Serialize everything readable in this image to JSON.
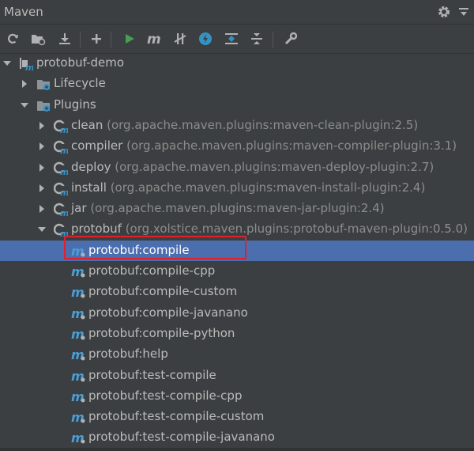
{
  "window": {
    "title": "Maven"
  },
  "colors": {
    "background": "#3c3f41",
    "selection": "#4b6eaf",
    "highlight_box": "#e0202a",
    "run_green": "#499c54",
    "skip_tests_blue": "#3592c4"
  },
  "toolbar": {
    "buttons": [
      {
        "name": "reimport",
        "icon": "refresh-icon"
      },
      {
        "name": "generate-sources",
        "icon": "generate-sources-icon"
      },
      {
        "name": "download",
        "icon": "download-icon"
      },
      {
        "name": "add-project",
        "icon": "plus-icon"
      },
      {
        "name": "run-goal",
        "icon": "run-icon"
      },
      {
        "name": "execute-maven-goal",
        "icon": "maven-m-icon"
      },
      {
        "name": "toggle-offline",
        "icon": "offline-icon"
      },
      {
        "name": "skip-tests",
        "icon": "skip-tests-icon"
      },
      {
        "name": "show-dependencies",
        "icon": "show-dependencies-icon"
      },
      {
        "name": "collapse-all",
        "icon": "collapse-all-icon"
      },
      {
        "name": "settings",
        "icon": "wrench-icon"
      }
    ]
  },
  "tree": {
    "root": {
      "label": "protobuf-demo"
    },
    "lifecycle": {
      "label": "Lifecycle"
    },
    "plugins": {
      "label": "Plugins",
      "items": [
        {
          "name": "clean",
          "coords": "(org.apache.maven.plugins:maven-clean-plugin:2.5)"
        },
        {
          "name": "compiler",
          "coords": "(org.apache.maven.plugins:maven-compiler-plugin:3.1)"
        },
        {
          "name": "deploy",
          "coords": "(org.apache.maven.plugins:maven-deploy-plugin:2.7)"
        },
        {
          "name": "install",
          "coords": "(org.apache.maven.plugins:maven-install-plugin:2.4)"
        },
        {
          "name": "jar",
          "coords": "(org.apache.maven.plugins:maven-jar-plugin:2.4)"
        },
        {
          "name": "protobuf",
          "coords": "(org.xolstice.maven.plugins:protobuf-maven-plugin:0.5.0)"
        }
      ]
    },
    "goals": [
      "protobuf:compile",
      "protobuf:compile-cpp",
      "protobuf:compile-custom",
      "protobuf:compile-javanano",
      "protobuf:compile-python",
      "protobuf:help",
      "protobuf:test-compile",
      "protobuf:test-compile-cpp",
      "protobuf:test-compile-custom",
      "protobuf:test-compile-javanano"
    ],
    "selected_goal": "protobuf:compile"
  }
}
